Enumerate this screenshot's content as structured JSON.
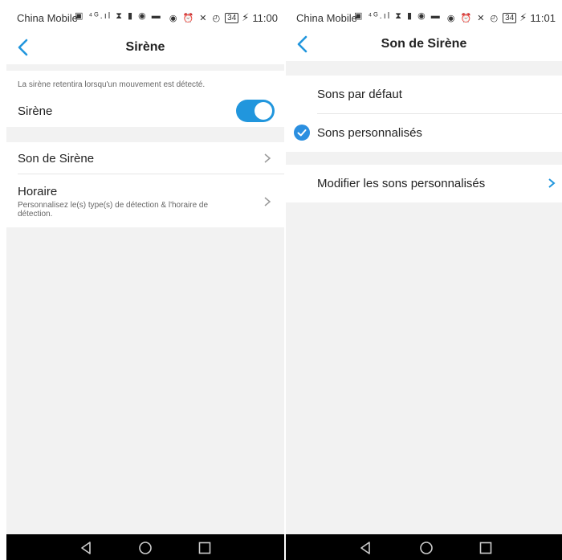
{
  "left": {
    "status": {
      "carrier": "China Mobile",
      "battery": "34",
      "time": "11:00"
    },
    "title": "Sirène",
    "note": "La sirène retentira lorsqu'un mouvement est détecté.",
    "siren_label": "Sirène",
    "siren_enabled": true,
    "son_de_sirene": "Son de Sirène",
    "horaire_label": "Horaire",
    "horaire_sub": "Personnalisez le(s) type(s) de détection & l'horaire de détection."
  },
  "right": {
    "status": {
      "carrier": "China Mobile",
      "battery": "34",
      "time": "11:01"
    },
    "title": "Son de Sirène",
    "options": [
      "Sons par défaut",
      "Sons personnalisés"
    ],
    "selected_option": "Sons personnalisés",
    "modify_label": "Modifier les sons personnalisés"
  },
  "colors": {
    "accent": "#2196dd",
    "background": "#f2f2f2",
    "navkeys": "#000000"
  },
  "icons": [
    "back-chevron-icon",
    "chevron-right-icon",
    "checkmark-icon",
    "back-triangle-icon",
    "home-circle-icon",
    "recents-square-icon"
  ]
}
